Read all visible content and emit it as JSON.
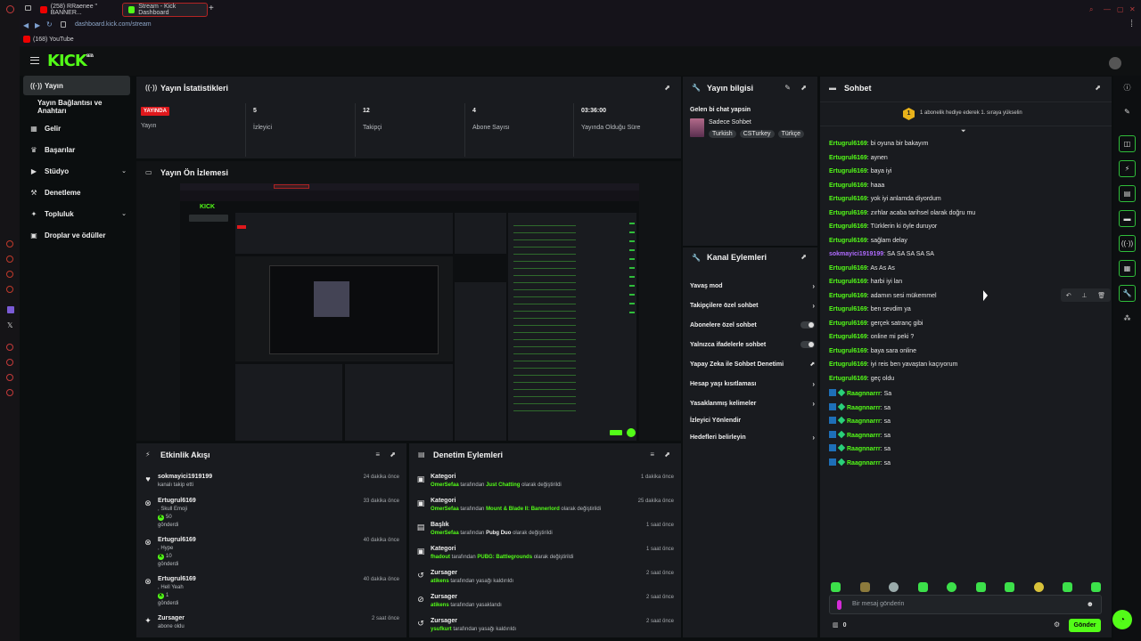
{
  "browser": {
    "tabs": [
      {
        "label": "(258) RRaenee \" BANNER..."
      },
      {
        "label": "Stream - Kick Dashboard"
      }
    ],
    "new_tab": "+",
    "address": "dashboard.kick.com/stream",
    "bookmark": "(168) YouTube"
  },
  "header": {
    "logo": "KICK",
    "logo_sup": "BETA"
  },
  "sidebar": {
    "items": [
      {
        "label": "Yayın",
        "icon": "broadcast-icon"
      },
      {
        "label": "Yayın Bağlantısı ve Anahtarı",
        "icon": ""
      },
      {
        "label": "Gelir",
        "icon": "revenue-icon"
      },
      {
        "label": "Başarılar",
        "icon": "achievements-icon"
      },
      {
        "label": "Stüdyo",
        "icon": "studio-icon"
      },
      {
        "label": "Denetleme",
        "icon": "moderation-icon"
      },
      {
        "label": "Topluluk",
        "icon": "community-icon"
      },
      {
        "label": "Droplar ve ödüller",
        "icon": "drops-icon"
      }
    ]
  },
  "stats": {
    "title": "Yayın İstatistikleri",
    "live_badge": "YAYINDA",
    "cells": [
      {
        "value": "",
        "label": "Yayın"
      },
      {
        "value": "5",
        "label": "İzleyici"
      },
      {
        "value": "12",
        "label": "Takipçi"
      },
      {
        "value": "4",
        "label": "Abone Sayısı"
      },
      {
        "value": "03:36:00",
        "label": "Yayında Olduğu Süre"
      }
    ]
  },
  "preview": {
    "title": "Yayın Ön İzlemesi"
  },
  "stream_info": {
    "title": "Yayın bilgisi",
    "stream_title": "Gelen bi chat yapsin",
    "category": "Sadece Sohbet",
    "tags": [
      "Turkish",
      "CSTurkey",
      "Türkçe"
    ]
  },
  "channel_actions": {
    "title": "Kanal Eylemleri",
    "items": [
      {
        "label": "Yavaş mod",
        "control": "chevron"
      },
      {
        "label": "Takipçilere özel sohbet",
        "control": "chevron"
      },
      {
        "label": "Abonelere özel sohbet",
        "control": "toggle"
      },
      {
        "label": "Yalnızca ifadelerle sohbet",
        "control": "toggle"
      },
      {
        "label": "Yapay Zeka ile Sohbet Denetimi",
        "control": "external"
      },
      {
        "label": "Hesap yaşı kısıtlaması",
        "control": "chevron"
      },
      {
        "label": "Yasaklanmış kelimeler",
        "control": "chevron"
      },
      {
        "label": "İzleyici Yönlendir",
        "control": "none"
      },
      {
        "label": "Hedefleri belirleyin",
        "control": "chevron"
      }
    ]
  },
  "activity": {
    "title": "Etkinlik Akışı",
    "items": [
      {
        "user": "sokmayici1919199",
        "line1": "kanalı takip etti",
        "line2": "",
        "line3": "",
        "time": "24 dakika önce"
      },
      {
        "user": "Ertugrul6169",
        "line1": ", Skull Emoji",
        "line2": "50",
        "line3": "gönderdi",
        "time": "33 dakika önce"
      },
      {
        "user": "Ertugrul6169",
        "line1": ", Hype",
        "line2": "10",
        "line3": "gönderdi",
        "time": "40 dakika önce"
      },
      {
        "user": "Ertugrul6169",
        "line1": ", Hell Yeah",
        "line2": "1",
        "line3": "gönderdi",
        "time": "40 dakika önce"
      },
      {
        "user": "Zursager",
        "line1": "abone oldu",
        "line2": "",
        "line3": "",
        "time": "2 saat önce"
      }
    ]
  },
  "mod_actions": {
    "title": "Denetim Eylemleri",
    "by_label": "tarafından",
    "items": [
      {
        "title": "Kategori",
        "actor": "OmerSefaa",
        "target": "Just Chatting",
        "suffix": "olarak değiştirildi",
        "time": "1 dakika önce"
      },
      {
        "title": "Kategori",
        "actor": "OmerSefaa",
        "target": "Mount & Blade II: Bannerlord",
        "suffix": "olarak değiştirildi",
        "time": "25 dakika önce"
      },
      {
        "title": "Başlık",
        "actor": "OmerSefaa",
        "target": "Pubg Duo",
        "suffix": "olarak değiştirildi",
        "time": "1 saat önce"
      },
      {
        "title": "Kategori",
        "actor": "fhadout",
        "target": "PUBG: Battlegrounds",
        "suffix": "olarak değiştirildi",
        "time": "1 saat önce"
      },
      {
        "title": "Zursager",
        "actor": "atikens",
        "target": "",
        "suffix": "yasağı kaldırıldı",
        "time": "2 saat önce"
      },
      {
        "title": "Zursager",
        "actor": "atikens",
        "target": "",
        "suffix": "yasaklandı",
        "time": "2 saat önce"
      },
      {
        "title": "Zursager",
        "actor": "ysufkurt",
        "target": "",
        "suffix": "yasağı kaldırıldı",
        "time": "2 saat önce"
      }
    ]
  },
  "chat": {
    "title": "Sohbet",
    "pinned": "1 abonelik hediye ederek 1. sıraya yükselin",
    "pinned_rank": "1",
    "messages": [
      {
        "user": "Ertugrul6169",
        "text": "bi oyuna bir bakayım",
        "style": "green"
      },
      {
        "user": "Ertugrul6169",
        "text": "aynen",
        "style": "green"
      },
      {
        "user": "Ertugrul6169",
        "text": "baya iyi",
        "style": "green"
      },
      {
        "user": "Ertugrul6169",
        "text": "haaa",
        "style": "green"
      },
      {
        "user": "Ertugrul6169",
        "text": "yok iyi anlamda diyordum",
        "style": "green"
      },
      {
        "user": "Ertugrul6169",
        "text": "zırhlar acaba tarihsel olarak doğru mu",
        "style": "green"
      },
      {
        "user": "Ertugrul6169",
        "text": "Türklerin ki öyle duruyor",
        "style": "green"
      },
      {
        "user": "Ertugrul6169",
        "text": "sağlam delay",
        "style": "green"
      },
      {
        "user": "sokmayici1919199",
        "text": "SA SA SA SA SA",
        "style": "purple"
      },
      {
        "user": "Ertugrul6169",
        "text": "As As As",
        "style": "green"
      },
      {
        "user": "Ertugrul6169",
        "text": "harbi iyi lan",
        "style": "green"
      },
      {
        "user": "Ertugrul6169",
        "text": "adamın sesi mükemmel",
        "style": "green"
      },
      {
        "user": "Ertugrul6169",
        "text": "ben sevdim ya",
        "style": "green"
      },
      {
        "user": "Ertugrul6169",
        "text": "gerçek satranç gibi",
        "style": "green"
      },
      {
        "user": "Ertugrul6169",
        "text": "online mi peki ?",
        "style": "green"
      },
      {
        "user": "Ertugrul6169",
        "text": "baya sara online",
        "style": "green"
      },
      {
        "user": "Ertugrul6169",
        "text": "iyi reis ben yavaştan kaçıyorum",
        "style": "green"
      },
      {
        "user": "Ertugrul6169",
        "text": "geç oldu",
        "style": "green"
      },
      {
        "user": "Raagnnarrr",
        "text": "Sa",
        "style": "badged"
      },
      {
        "user": "Raagnnarrr",
        "text": "sa",
        "style": "badged"
      },
      {
        "user": "Raagnnarrr",
        "text": "sa",
        "style": "badged"
      },
      {
        "user": "Raagnnarrr",
        "text": "sa",
        "style": "badged"
      },
      {
        "user": "Raagnnarrr",
        "text": "sa",
        "style": "badged"
      },
      {
        "user": "Raagnnarrr",
        "text": "sa",
        "style": "badged"
      }
    ],
    "input_placeholder": "Bir mesaj gönderin",
    "viewer_count": "0",
    "send_label": "Gönder"
  },
  "colors": {
    "brand": "#53fc18",
    "live": "#e0181c",
    "panel": "#191b1f",
    "background": "#0b0e0f"
  }
}
